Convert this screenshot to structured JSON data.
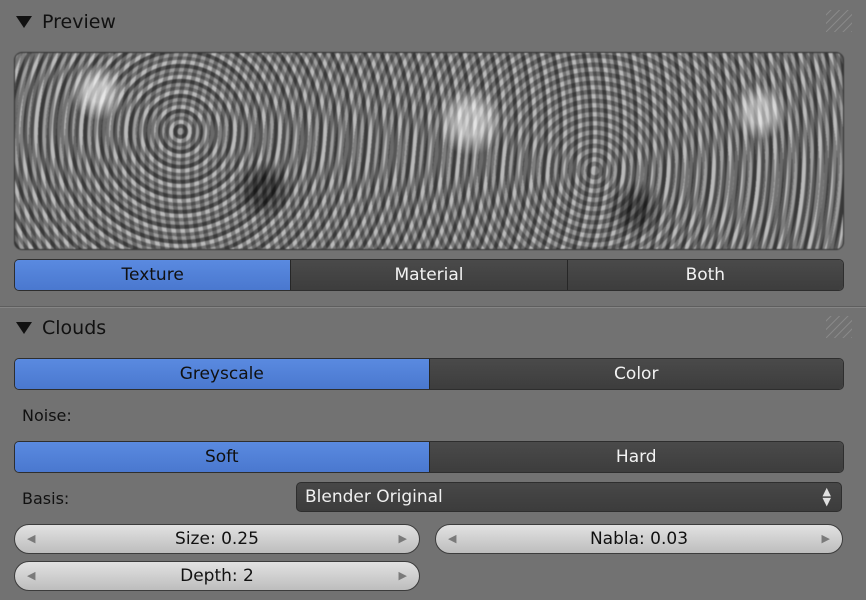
{
  "preview_panel": {
    "title": "Preview"
  },
  "preview_modes": {
    "texture": "Texture",
    "material": "Material",
    "both": "Both"
  },
  "clouds_panel": {
    "title": "Clouds"
  },
  "color_modes": {
    "greyscale": "Greyscale",
    "color": "Color"
  },
  "noise": {
    "label": "Noise:",
    "soft": "Soft",
    "hard": "Hard"
  },
  "basis": {
    "label": "Basis:",
    "value": "Blender Original"
  },
  "fields": {
    "size": "Size: 0.25",
    "nabla": "Nabla: 0.03",
    "depth": "Depth: 2"
  },
  "colors": {
    "active": "#5a8ae0",
    "panel_bg": "#727272",
    "button_bg": "#444444"
  },
  "icons": {
    "collapse": "triangle-down-icon",
    "grip": "grip-icon",
    "left": "arrow-left-icon",
    "right": "arrow-right-icon",
    "updown": "updown-arrows-icon"
  }
}
